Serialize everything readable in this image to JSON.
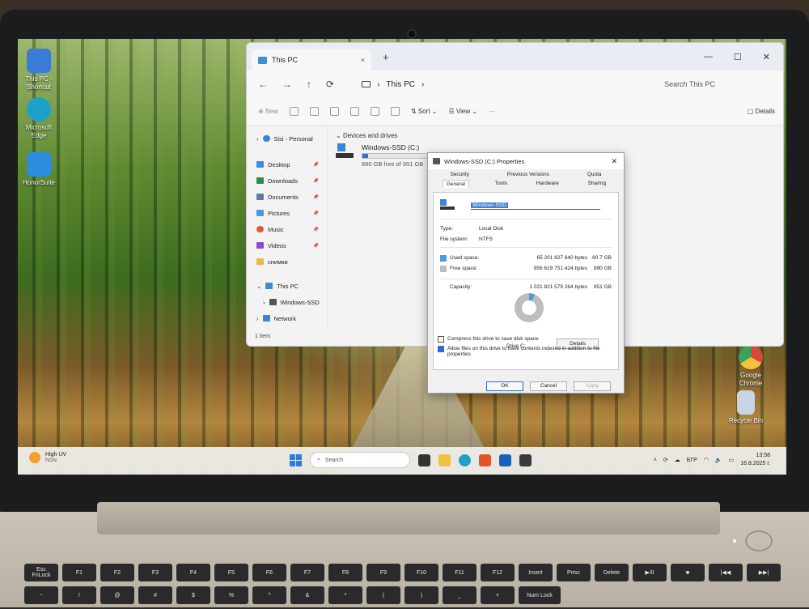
{
  "desktop": {
    "icons": [
      {
        "label": "This PC -\nShortcut",
        "color": "#3a7bd5"
      },
      {
        "label": "Microsoft\nEdge",
        "color": "#1fa0c9"
      },
      {
        "label": "HonorSuite",
        "color": "#2d8be0"
      },
      {
        "label": "Google\nChrome",
        "color": "#e6b12e"
      },
      {
        "label": "Recycle Bin",
        "color": "#c8d4e4"
      }
    ]
  },
  "explorer": {
    "tab_title": "This PC",
    "tab_close": "×",
    "new_tab": "+",
    "window_controls": [
      "—",
      "☐",
      "✕"
    ],
    "nav_buttons": [
      "←",
      "→",
      "↑",
      "⟳"
    ],
    "address": "This PC",
    "address_chevron": "›",
    "search_placeholder": "Search This PC",
    "commands": {
      "new": "New",
      "sort": "Sort",
      "view": "View",
      "more": "···",
      "details": "Details"
    },
    "sidebar": {
      "account": "Sisi - Personal",
      "quick_access": [
        {
          "label": "Desktop",
          "color": "#3a8ee0",
          "pinned": true
        },
        {
          "label": "Downloads",
          "color": "#2f8a4a",
          "pinned": true
        },
        {
          "label": "Documents",
          "color": "#5c7ba8",
          "pinned": true
        },
        {
          "label": "Pictures",
          "color": "#4a98d8",
          "pinned": true
        },
        {
          "label": "Music",
          "color": "#e0553c",
          "pinned": true
        },
        {
          "label": "Videos",
          "color": "#8a4fd0",
          "pinned": true
        },
        {
          "label": "снимки",
          "color": "#e8b84a",
          "pinned": false
        }
      ],
      "this_pc": "This PC",
      "windows_ssd": "Windows-SSD",
      "network": "Network",
      "pin_glyph": "📌"
    },
    "section_header": "Devices and drives",
    "drive": {
      "name": "Windows-SSD (C:)",
      "free_text": "890 GB free of 951 GB",
      "used_fraction": 0.064
    },
    "status": "1 item"
  },
  "properties": {
    "title": "Windows-SSD (C:) Properties",
    "close": "✕",
    "tabs_row1": [
      "Security",
      "Previous Versions",
      "Quota"
    ],
    "tabs_row2": [
      "General",
      "Tools",
      "Hardware",
      "Sharing"
    ],
    "active_tab": "General",
    "volume_name": "Windows-SSD",
    "type_label": "Type:",
    "type_value": "Local Disk",
    "fs_label": "File system:",
    "fs_value": "NTFS",
    "used_label": "Used space:",
    "used_bytes": "65 201 827 840 bytes",
    "used_size": "60.7 GB",
    "used_color": "#4a9ee0",
    "free_label": "Free space:",
    "free_bytes": "956 619 751 424 bytes",
    "free_size": "890 GB",
    "free_color": "#bdbdbd",
    "capacity_label": "Capacity:",
    "capacity_bytes": "1 021 821 579 264 bytes",
    "capacity_size": "951 GB",
    "drive_label": "Drive C:",
    "details_button": "Details",
    "compress_label": "Compress this drive to save disk space",
    "compress_checked": false,
    "index_label": "Allow files on this drive to have contents indexed in addition to file properties",
    "index_checked": true,
    "ok": "OK",
    "cancel": "Cancel",
    "apply": "Apply"
  },
  "taskbar": {
    "weather_title": "High UV",
    "weather_sub": "Now",
    "search_placeholder": "Search",
    "apps": [
      {
        "name": "task-view",
        "color": "#333333"
      },
      {
        "name": "file-explorer",
        "color": "#f0c040"
      },
      {
        "name": "edge",
        "color": "#1fa0c9"
      },
      {
        "name": "store",
        "color": "#e0552a"
      },
      {
        "name": "l-app",
        "color": "#1c5fb8"
      },
      {
        "name": "dropbox",
        "color": "#3a3a3a"
      }
    ],
    "language": "БГР",
    "time": "13:58",
    "date": "16.8.2025 г."
  },
  "keyboard": {
    "row1": [
      "Esc\nFnLock",
      "F1",
      "F2",
      "F3",
      "F4",
      "F5",
      "F6",
      "F7",
      "F8",
      "F9",
      "F10",
      "F11",
      "F12",
      "Insert",
      "Prtsc",
      "Delete",
      "▶/II",
      "■",
      "|◀◀",
      "▶▶|"
    ],
    "row2": [
      "~",
      "!",
      "@",
      "#",
      "$",
      "%",
      "^",
      "&",
      "*",
      "(",
      ")",
      "_",
      "+",
      "Num Lock"
    ]
  }
}
